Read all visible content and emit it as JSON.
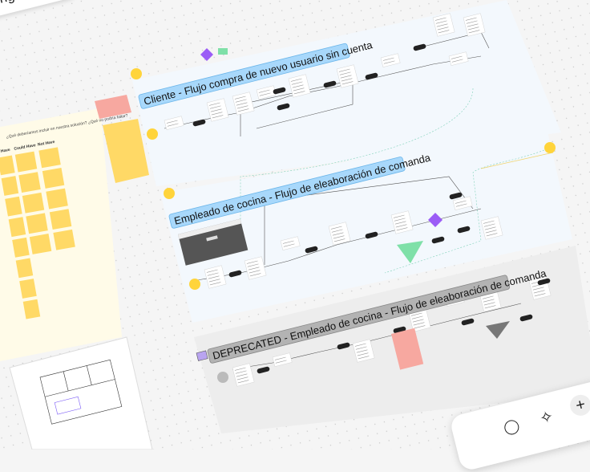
{
  "board": {
    "heading_card": "nge solution",
    "sections": [
      {
        "title": "Cliente - Flujo compra de nuevo usuario sin cuenta",
        "color": "#a8d8fb"
      },
      {
        "title": "Empleado de cocina - Flujo de eleaboración de comanda",
        "color": "#a8d8fb"
      },
      {
        "title": "DEPRECATED - Empleado de cocina - Flujo de eleaboración de comanda",
        "color": "#b3b3b3"
      }
    ],
    "prioritization": {
      "question": "¿Qué deberíamos incluir en nuestra solución? ¿Qué no podría faltar?",
      "columns": [
        "t Have",
        "Could Have",
        "Not Have"
      ]
    }
  },
  "colors": {
    "sticky_yellow": "#ffd966",
    "sticky_pink": "#f7a8a0",
    "panel_blue": "#f3f8fd",
    "panel_grey": "#ededed",
    "accent_purple": "#9b5cf6",
    "accent_green": "#7fe0a8"
  },
  "toolbar": {
    "icons": [
      "shape-circle-icon",
      "ai-sparkle-icon",
      "add-icon"
    ]
  }
}
